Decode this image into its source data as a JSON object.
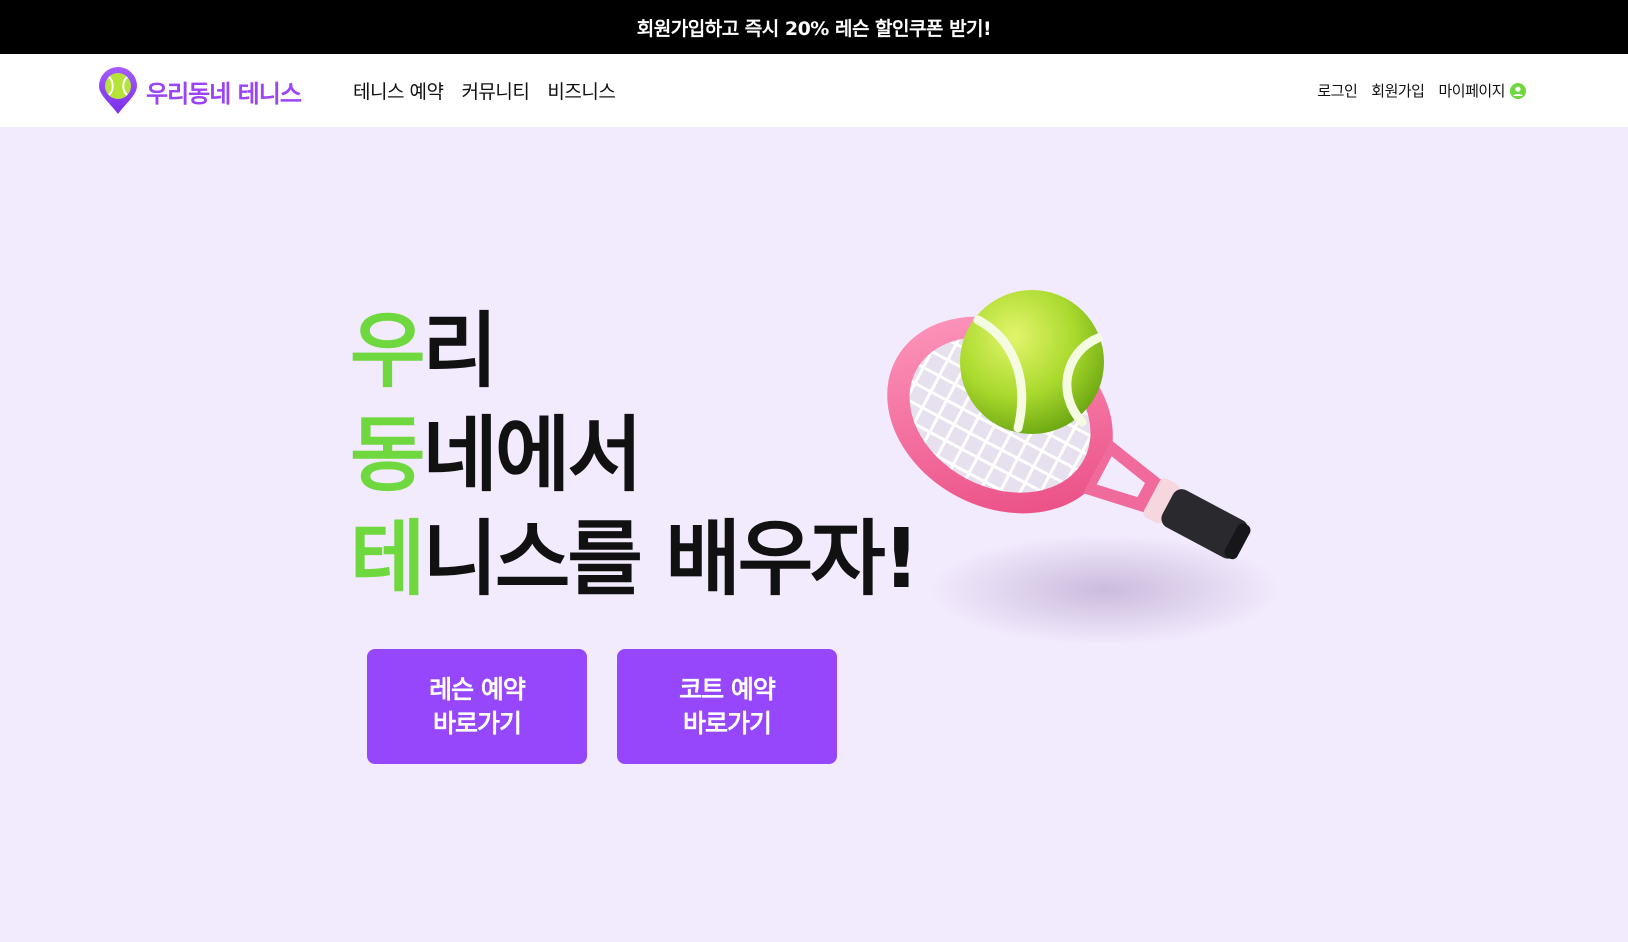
{
  "promo": {
    "text": "회원가입하고 즉시 20% 레슨 할인쿠폰 받기!"
  },
  "header": {
    "logo_text": "우리동네 테니스",
    "nav": [
      {
        "label": "테니스 예약"
      },
      {
        "label": "커뮤니티"
      },
      {
        "label": "비즈니스"
      }
    ],
    "util": {
      "login": "로그인",
      "signup": "회원가입",
      "mypage": "마이페이지"
    }
  },
  "hero": {
    "lines": [
      {
        "accent": "우",
        "rest": "리"
      },
      {
        "accent": "동",
        "rest": "네에서"
      },
      {
        "accent": "테",
        "rest": "니스를 배우자!"
      }
    ],
    "buttons": {
      "lesson": {
        "line1": "레슨 예약",
        "line2": "바로가기"
      },
      "court": {
        "line1": "코트 예약",
        "line2": "바로가기"
      }
    }
  },
  "colors": {
    "brand_purple": "#9747fb",
    "accent_green": "#6fd83f",
    "hero_bg": "#f2eafd",
    "promo_bg": "#000000"
  },
  "icons": {
    "logo": "map-pin-tennis-ball-icon",
    "mypage": "user-circle-icon"
  }
}
